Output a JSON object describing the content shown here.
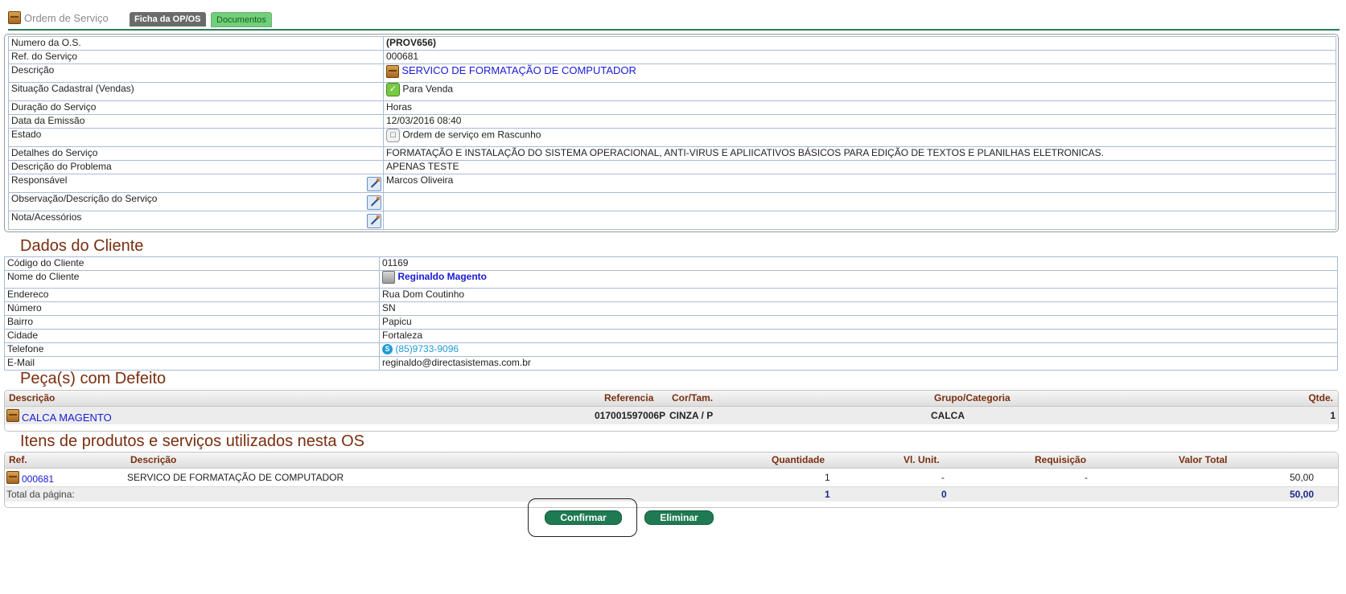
{
  "header": {
    "title": "Ordem de Serviço",
    "tabs": [
      {
        "label": "Ficha da OP/OS"
      },
      {
        "label": "Documentos"
      }
    ]
  },
  "os": {
    "rows": [
      {
        "label": "Numero da O.S.",
        "value": "(PROV656)"
      },
      {
        "label": "Ref. do Serviço",
        "value": "000681"
      },
      {
        "label": "Descrição",
        "value": "SERVICO DE FORMATAÇÃO DE COMPUTADOR"
      },
      {
        "label": "Situação Cadastral (Vendas)",
        "value": "Para Venda"
      },
      {
        "label": "Duração do Serviço",
        "value": "Horas"
      },
      {
        "label": "Data da Emissão",
        "value": "12/03/2016 08:40"
      },
      {
        "label": "Estado",
        "value": "Ordem de serviço em Rascunho"
      },
      {
        "label": "Detalhes do Serviço",
        "value": "FORMATAÇÃO E INSTALAÇÃO DO SISTEMA OPERACIONAL, ANTI-VIRUS E APLIICATIVOS BÁSICOS PARA EDIÇÃO DE TEXTOS E PLANILHAS ELETRONICAS."
      },
      {
        "label": "Descrição do Problema",
        "value": "APENAS TESTE"
      },
      {
        "label": "Responsável",
        "value": "Marcos Oliveira"
      },
      {
        "label": "Observação/Descrição do Serviço",
        "value": ""
      },
      {
        "label": "Nota/Acessórios",
        "value": ""
      }
    ]
  },
  "cliente": {
    "title": "Dados do Cliente",
    "rows": [
      {
        "label": "Código do Cliente",
        "value": "01169"
      },
      {
        "label": "Nome do Cliente",
        "value": "Reginaldo Magento"
      },
      {
        "label": "Endereco",
        "value": "Rua Dom Coutinho"
      },
      {
        "label": "Número",
        "value": "SN"
      },
      {
        "label": "Bairro",
        "value": "Papicu"
      },
      {
        "label": "Cidade",
        "value": "Fortaleza"
      },
      {
        "label": "Telefone",
        "value": "(85)9733-9096"
      },
      {
        "label": "E-Mail",
        "value": "reginaldo@directasistemas.com.br"
      }
    ]
  },
  "pecas": {
    "title": "Peça(s) com Defeito",
    "headers": {
      "descricao": "Descrição",
      "referencia": "Referencia",
      "cor": "Cor/Tam.",
      "grupo": "Grupo/Categoria",
      "qtde": "Qtde."
    },
    "rows": [
      {
        "descricao": "CALCA MAGENTO",
        "referencia": "017001597006P",
        "cor": "CINZA / P",
        "grupo": "CALCA",
        "qtde": "1"
      }
    ]
  },
  "itens": {
    "title": "Itens de produtos e serviços utilizados nesta OS",
    "headers": {
      "ref": "Ref.",
      "descricao": "Descrição",
      "quantidade": "Quantidade",
      "vl_unit": "Vl. Unit.",
      "requisicao": "Requisição",
      "valor_total": "Valor Total"
    },
    "rows": [
      {
        "ref": "000681",
        "descricao": "SERVICO DE FORMATAÇÃO DE COMPUTADOR",
        "quantidade": "1",
        "vl_unit": "-",
        "requisicao": "-",
        "valor_total": "50,00"
      }
    ],
    "total": {
      "label": "Total da página:",
      "quantidade": "1",
      "vl_unit": "0",
      "valor_total": "50,00"
    }
  },
  "actions": {
    "confirm": "Confirmar",
    "delete": "Eliminar"
  },
  "colors": {
    "accent": "#1f7a52",
    "section_title": "#7a2e0e",
    "link": "#1a1ad4"
  }
}
